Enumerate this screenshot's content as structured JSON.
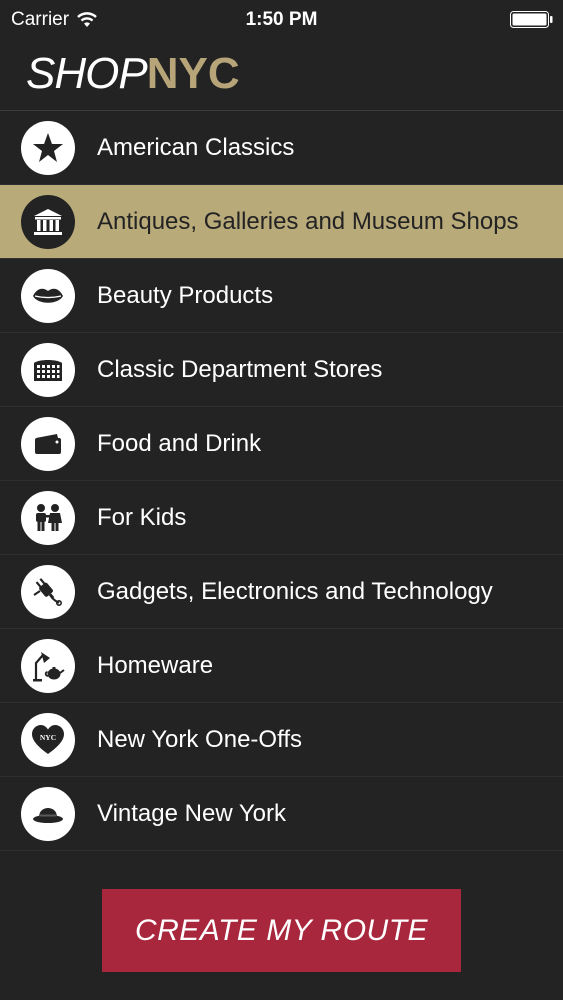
{
  "status_bar": {
    "carrier": "Carrier",
    "time": "1:50 PM",
    "wifi_icon": "wifi-icon",
    "battery_icon": "battery-icon"
  },
  "header": {
    "logo_part1": "SHOP",
    "logo_part2": "NYC"
  },
  "colors": {
    "background": "#232323",
    "accent_gold": "#b9aa7a",
    "button_red": "#a8273d"
  },
  "categories": [
    {
      "label": "American Classics",
      "icon": "star-icon",
      "selected": false
    },
    {
      "label": "Antiques, Galleries and Museum Shops",
      "icon": "museum-icon",
      "selected": true
    },
    {
      "label": "Beauty Products",
      "icon": "lips-icon",
      "selected": false
    },
    {
      "label": "Classic Department Stores",
      "icon": "department-store-icon",
      "selected": false
    },
    {
      "label": "Food and Drink",
      "icon": "wallet-icon",
      "selected": false
    },
    {
      "label": "For Kids",
      "icon": "kids-icon",
      "selected": false
    },
    {
      "label": "Gadgets, Electronics and Technology",
      "icon": "plug-icon",
      "selected": false
    },
    {
      "label": "Homeware",
      "icon": "lamp-teapot-icon",
      "selected": false
    },
    {
      "label": "New York One-Offs",
      "icon": "nyc-heart-icon",
      "selected": false,
      "icon_text": "NYC"
    },
    {
      "label": "Vintage New York",
      "icon": "bowler-hat-icon",
      "selected": false
    }
  ],
  "create_route_label": "CREATE MY ROUTE"
}
